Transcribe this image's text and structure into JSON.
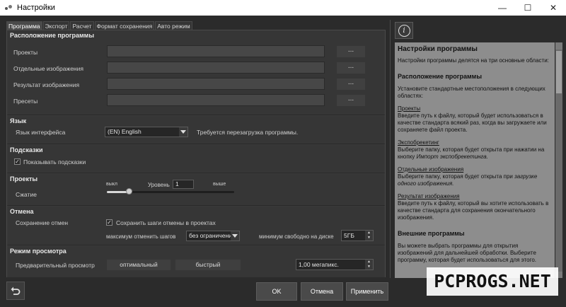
{
  "window": {
    "title": "Настройки",
    "controls": [
      "—",
      "☐",
      "✕"
    ]
  },
  "tabs": [
    "Программа",
    "Экспорт",
    "Расчет",
    "Формат сохранения",
    "Авто режим"
  ],
  "sections": {
    "location": {
      "title": "Расположение программы",
      "rows": [
        {
          "label": "Проекты",
          "value": "",
          "button": "..."
        },
        {
          "label": "Отдельные изображения",
          "value": "",
          "button": "..."
        },
        {
          "label": "Результат изображения",
          "value": "",
          "button": "..."
        },
        {
          "label": "Пресеты",
          "value": "",
          "button": "..."
        }
      ]
    },
    "language": {
      "title": "Язык",
      "label": "Язык интерфейса",
      "selected": "(EN) English",
      "note": "Требуется перезагрузка программы."
    },
    "hints": {
      "title": "Подсказки",
      "checkbox_label": "Показывать подсказки",
      "checked": true
    },
    "projects": {
      "title": "Проекты",
      "label": "Сжатие",
      "low": "выкл",
      "high": "выше",
      "level_label": "Уровень",
      "level": "1",
      "level_fraction": 0.18
    },
    "undo": {
      "title": "Отмена",
      "label": "Сохранение отмен",
      "checkbox_label": "Сохранить шаги отмены в проектах",
      "checked": true,
      "max_label": "максимум отменить шагов",
      "max_value": "без ограничени",
      "min_free_label": "минимум свободно на диске",
      "min_free_value": "5ГБ"
    },
    "view": {
      "title": "Режим просмотра",
      "label": "Предварительный просмотр",
      "option1": "оптимальный",
      "option2": "быстрый",
      "value": "1,00 мегапикс."
    }
  },
  "buttons": {
    "ok": "OK",
    "cancel": "Отмена",
    "apply": "Применить"
  },
  "help": {
    "title": "Настройки программы",
    "intro": "Настройки программы делятся на три основные области:",
    "h_location": "Расположение программы",
    "p_location": "Установите стандартные местоположения в следующих областях:",
    "projects_head": "Проекты",
    "projects_text": "Введите путь к файлу, который будет использоваться в качестве стандарта всякий раз, когда вы загружаете или сохраняете файл проекта.",
    "bracket_head": "Экспобрекетинг",
    "bracket_text_pre": "Выберите папку, которая будет открыта при нажатии на кнопку ",
    "bracket_text_em": "Импорт экспобрекетинга.",
    "single_head": "Отдельные изображения",
    "single_text_pre": "Выберите папку, которая будет открыта при ",
    "single_text_em": "загрузке одного изображения.",
    "result_head": "Результат изображения",
    "result_text": "Введите путь к файлу, который вы хотите использовать в качестве стандарта для сохранения окончательного изображения.",
    "h_external": "Внешние программы",
    "p_external": "Вы можете выбрать программы для открытия изображений для дальнейшей обработки. Выберите программу, которая будет использоваться для этого."
  },
  "watermark": "PCPROGS.NET"
}
